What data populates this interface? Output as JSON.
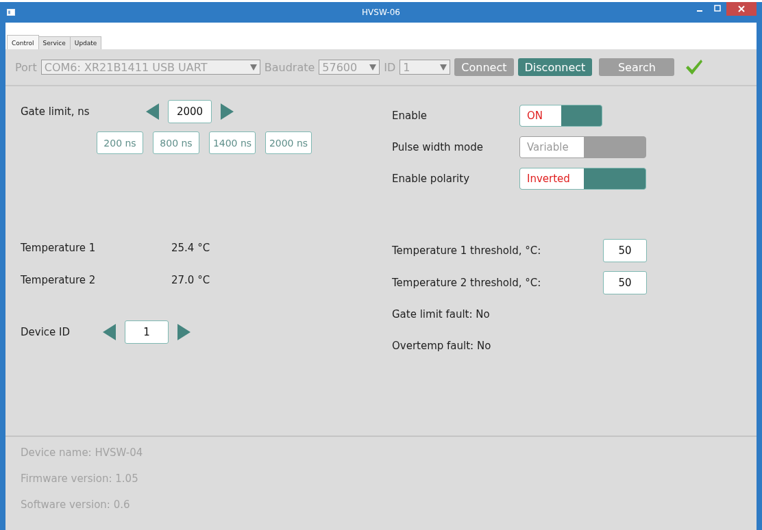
{
  "window": {
    "title": "HVSW-06"
  },
  "tabs": [
    {
      "label": "Control",
      "selected": true
    },
    {
      "label": "Service",
      "selected": false
    },
    {
      "label": "Update",
      "selected": false
    }
  ],
  "connection": {
    "port_label": "Port",
    "port": "COM6: XR21B1411 USB UART",
    "baudrate_label": "Baudrate",
    "baudrate": "57600",
    "id_label": "ID",
    "id": "1",
    "buttons": [
      {
        "label": "Connect",
        "kind": "plain"
      },
      {
        "label": "Disconnect",
        "kind": "accent"
      },
      {
        "label": "Search",
        "kind": "plain"
      }
    ],
    "connected": true
  },
  "gate_limit": {
    "label": "Gate limit, ns",
    "value": "2000",
    "presets": [
      "200 ns",
      "800 ns",
      "1400 ns",
      "2000 ns"
    ]
  },
  "switches": [
    {
      "label": "Enable",
      "value": "ON",
      "disabled": false
    },
    {
      "label": "Pulse width mode",
      "value": "Variable",
      "disabled": true
    },
    {
      "label": "Enable polarity",
      "value": "Inverted",
      "disabled": false
    }
  ],
  "temperatures": [
    {
      "label": "Temperature 1",
      "reading": "25.4 °C"
    },
    {
      "label": "Temperature 2",
      "reading": "27.0 °C"
    }
  ],
  "device_id": {
    "label": "Device ID",
    "value": "1"
  },
  "thresholds": [
    {
      "label": "Temperature 1 threshold, °C:",
      "value": "50"
    },
    {
      "label": "Temperature 2 threshold, °C:",
      "value": "50"
    }
  ],
  "faults": [
    "Gate limit fault: No",
    "Overtemp fault: No"
  ],
  "footer": [
    "Device name: HVSW-04",
    "Firmware version: 1.05",
    "Software version: 0.6"
  ]
}
